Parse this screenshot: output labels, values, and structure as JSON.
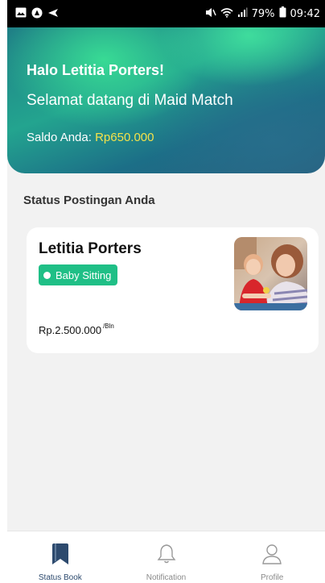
{
  "status_bar": {
    "battery": "79%",
    "time": "09:42",
    "icons": [
      "gallery-icon",
      "app-notification-icon",
      "send-icon",
      "mute-icon",
      "wifi-icon",
      "signal-icon",
      "battery-icon"
    ]
  },
  "header": {
    "greeting": "Halo Letitia Porters!",
    "welcome": "Selamat datang di Maid Match",
    "saldo_label": "Saldo Anda: ",
    "saldo_amount": "Rp650.000"
  },
  "section": {
    "title": "Status Postingan Anda"
  },
  "posting_card": {
    "name": "Letitia Porters",
    "tag": "Baby Sitting",
    "price": "Rp.2.500.000",
    "price_unit": "/Bln",
    "photo": "babysitter-photo"
  },
  "bottom_nav": {
    "items": [
      {
        "label": "Status Book",
        "icon": "bookmark-icon",
        "active": true
      },
      {
        "label": "Notification",
        "icon": "bell-icon",
        "active": false
      },
      {
        "label": "Profile",
        "icon": "user-icon",
        "active": false
      }
    ]
  },
  "colors": {
    "accent": "#1fbf86",
    "saldo": "#f4e24a",
    "nav_active": "#2d4a6e"
  }
}
